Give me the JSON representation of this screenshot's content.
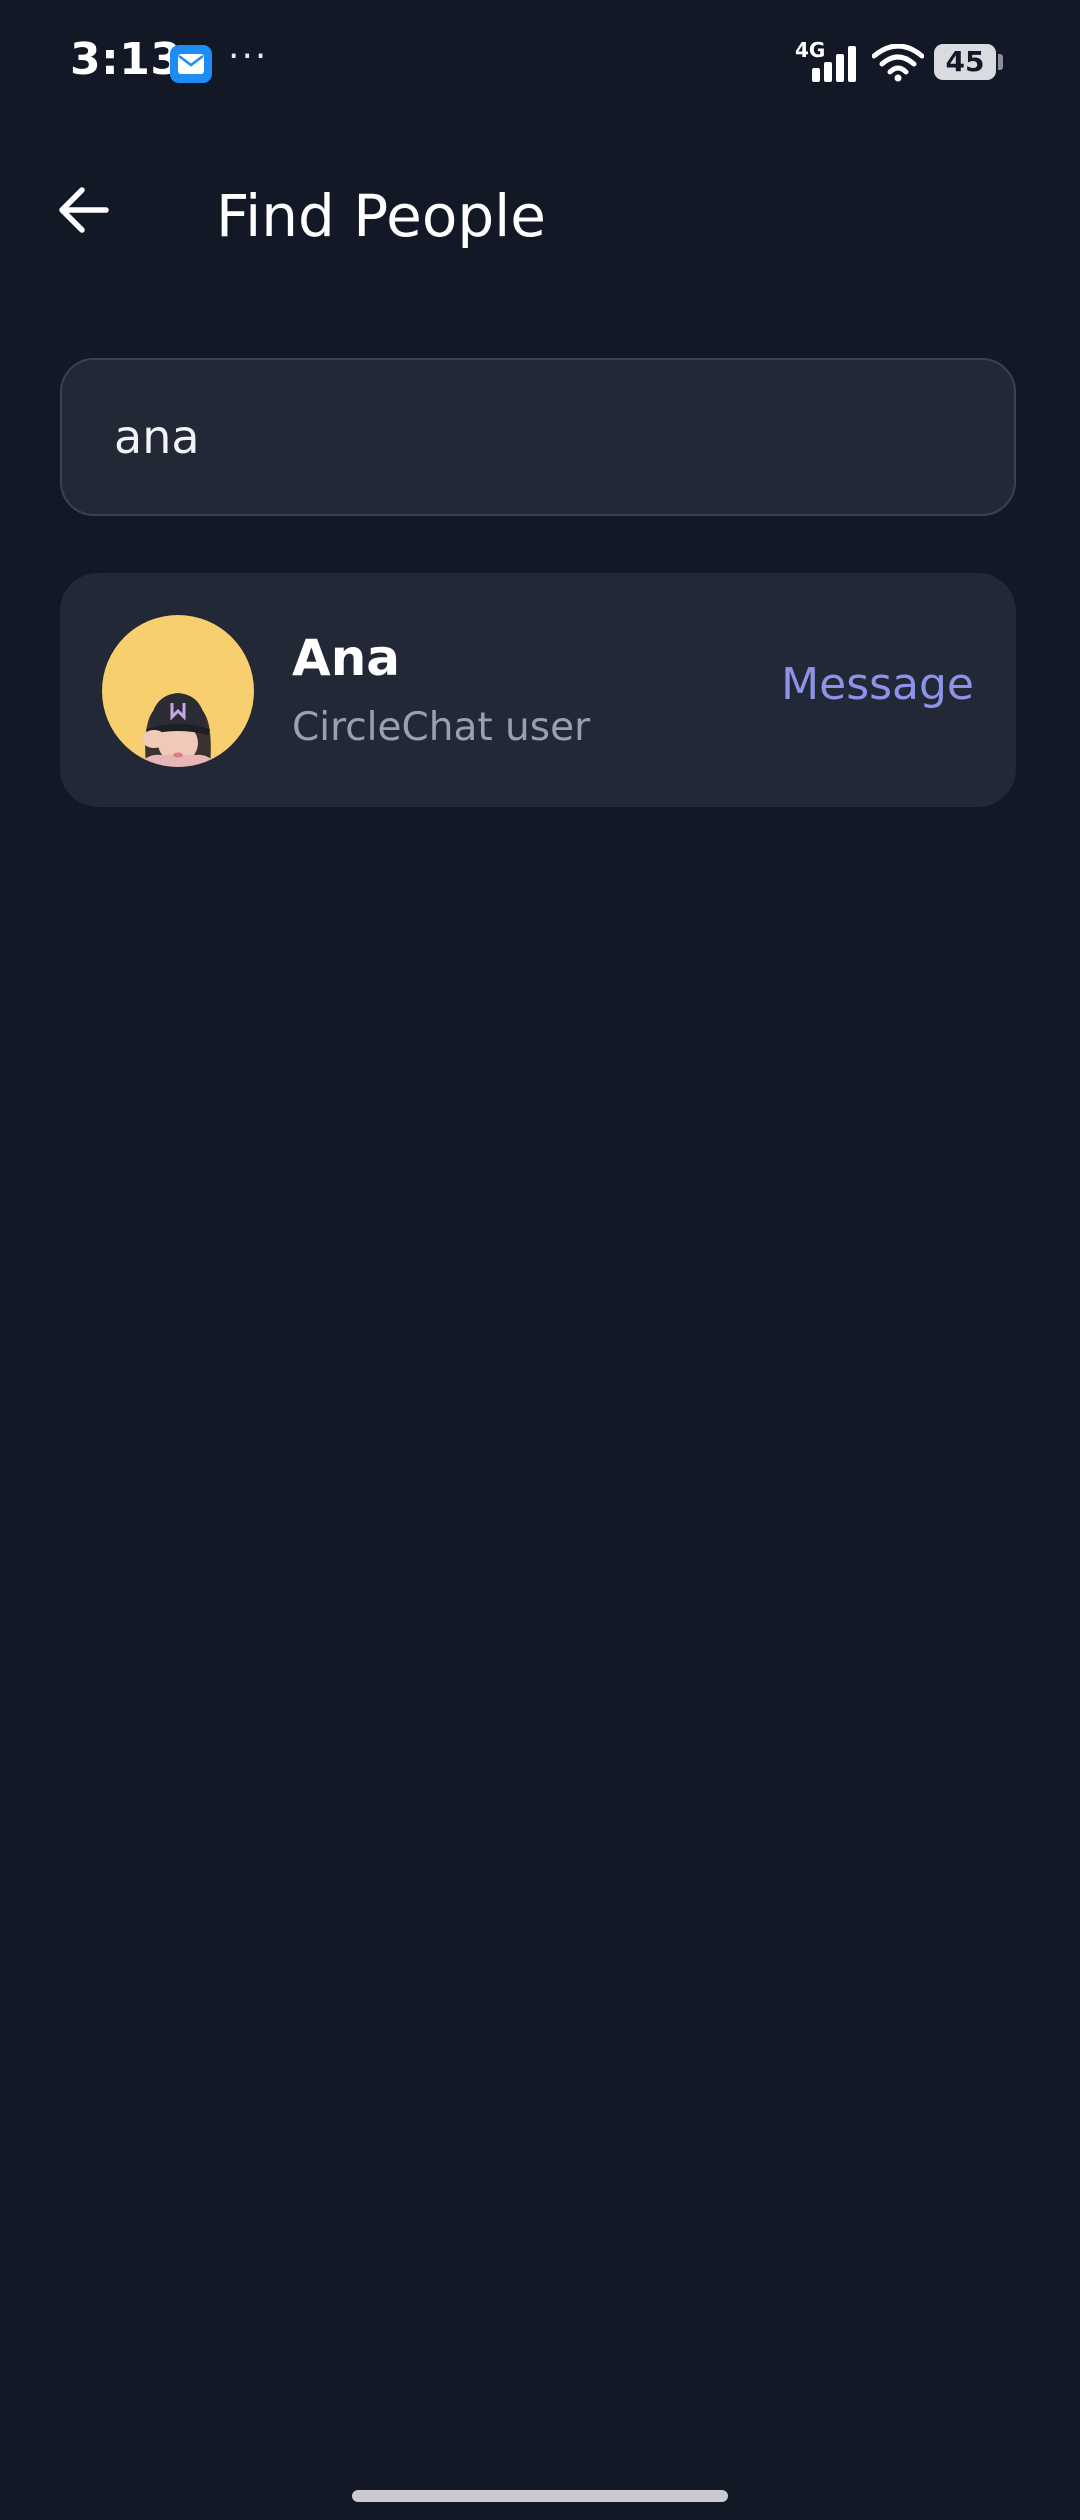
{
  "status_bar": {
    "time": "3:13",
    "notification_icons": [
      "mail-icon",
      "more-dots-icon"
    ],
    "more_indicator": "···",
    "network_type": "4G",
    "battery_level": "45"
  },
  "header": {
    "title": "Find People",
    "back_icon": "arrow-left-icon"
  },
  "search": {
    "value": "ana",
    "placeholder": ""
  },
  "results": [
    {
      "name": "Ana",
      "subtitle": "CircleChat user",
      "action_label": "Message",
      "avatar_background": "#f7cf6e"
    }
  ],
  "colors": {
    "background": "#131826",
    "surface": "#222836",
    "accent": "#8c93e8",
    "secondary_text": "#9aa0ad"
  }
}
